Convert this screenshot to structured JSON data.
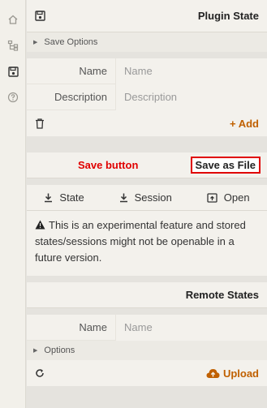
{
  "rail": {
    "items": [
      {
        "icon": "home-icon"
      },
      {
        "icon": "tree-icon"
      },
      {
        "icon": "floppy-icon",
        "active": true
      },
      {
        "icon": "help-icon"
      }
    ]
  },
  "plugin_state": {
    "title": "Plugin State",
    "save_options_label": "Save Options",
    "name_label": "Name",
    "name_placeholder": "Name",
    "description_label": "Description",
    "description_placeholder": "Description",
    "add_label": "+ Add"
  },
  "save": {
    "annotation": "Save button",
    "save_as_file_label": "Save as File",
    "state_label": "State",
    "session_label": "Session",
    "open_label": "Open",
    "warning": "This is an experimental feature and stored states/sessions might not be openable in a future version."
  },
  "remote_states": {
    "title": "Remote States",
    "name_label": "Name",
    "name_placeholder": "Name",
    "options_label": "Options",
    "upload_label": "Upload"
  },
  "colors": {
    "accent": "#c06000",
    "annotation": "#e00000"
  }
}
